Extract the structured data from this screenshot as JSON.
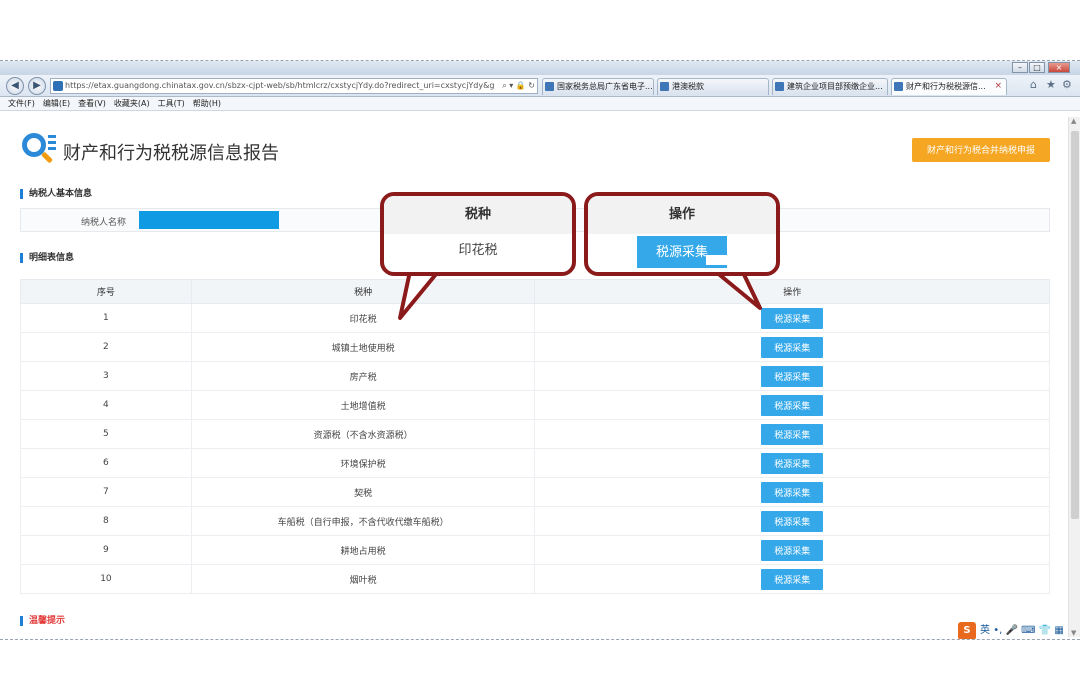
{
  "browser": {
    "url": "https://etax.guangdong.chinatax.gov.cn/sbzx-cjpt-web/sb/htmlcrz/cxstycjYdy.do?redirect_uri=cxstycjYdy&g",
    "tabs": [
      "国家税务总局广东省电子...",
      "港澳税款",
      "建筑企业项目部预缴企业...",
      "财产和行为税税源信..."
    ],
    "menu": [
      "文件(F)",
      "编辑(E)",
      "查看(V)",
      "收藏夹(A)",
      "工具(T)",
      "帮助(H)"
    ]
  },
  "page": {
    "title": "财产和行为税税源信息报告",
    "merge_button": "财产和行为税合并纳税申报",
    "taxpayer_section": "纳税人基本信息",
    "taxpayer_name_label": "纳税人名称",
    "detail_section": "明细表信息",
    "tips_section": "温馨提示"
  },
  "table": {
    "headers": [
      "序号",
      "税种",
      "操作"
    ],
    "action_label": "税源采集",
    "rows": [
      {
        "no": "1",
        "tax": "印花税"
      },
      {
        "no": "2",
        "tax": "城镇土地使用税"
      },
      {
        "no": "3",
        "tax": "房产税"
      },
      {
        "no": "4",
        "tax": "土地增值税"
      },
      {
        "no": "5",
        "tax": "资源税（不含水资源税）"
      },
      {
        "no": "6",
        "tax": "环境保护税"
      },
      {
        "no": "7",
        "tax": "契税"
      },
      {
        "no": "8",
        "tax": "车船税（自行申报，不含代收代缴车船税）"
      },
      {
        "no": "9",
        "tax": "耕地占用税"
      },
      {
        "no": "10",
        "tax": "烟叶税"
      }
    ]
  },
  "callouts": {
    "left": {
      "header": "税种",
      "body": "印花税"
    },
    "right": {
      "header": "操作",
      "button": "税源采集"
    }
  },
  "ime": {
    "brand": "S",
    "lang": "英"
  },
  "colors": {
    "accent_blue": "#34a8e9",
    "orange": "#f5a623",
    "callout_border": "#8b1a1a"
  }
}
